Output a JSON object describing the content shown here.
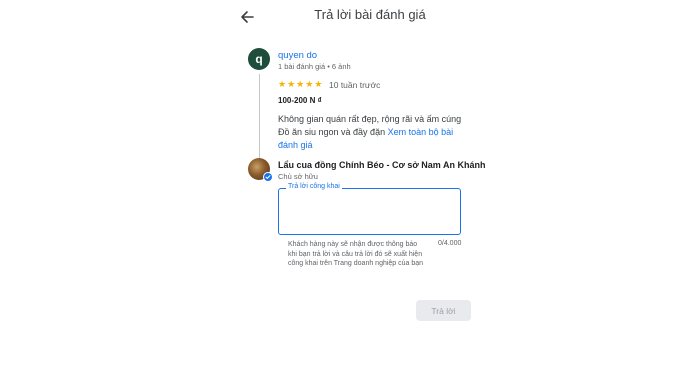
{
  "header": {
    "title": "Trả lời bài đánh giá"
  },
  "review": {
    "avatar_letter": "q",
    "avatar_color": "#1e4d3b",
    "reviewer_name": "quyen do",
    "reviewer_meta": "1 bài đánh giá • 6 ảnh",
    "rating": 5,
    "star_color": "#f4b400",
    "time": "10 tuần trước",
    "price": "100-200 N ₫",
    "text_line1": "Không gian quán rất đẹp, rộng rãi và ấm cúng",
    "text_line2": "Đồ ăn siu ngon và đầy đặn",
    "see_more": "Xem toàn bộ bài",
    "see_more_2": "đánh giá"
  },
  "owner": {
    "name": "Lẩu cua đồng Chính Béo - Cơ sở Nam An Khánh",
    "role": "Chủ sở hữu"
  },
  "reply": {
    "label": "Trả lời công khai",
    "value": "",
    "helper": "Khách hàng này sẽ nhận được thông báo khi bạn trả lời và câu trả lời đó sẽ xuất hiện công khai trên Trang doanh nghiệp của bạn",
    "char_count": "0/4.000",
    "submit_label": "Trả lời"
  },
  "colors": {
    "accent": "#1a73e8",
    "disabled_button_bg": "#e8eaed",
    "disabled_button_text": "#9aa0a6"
  }
}
